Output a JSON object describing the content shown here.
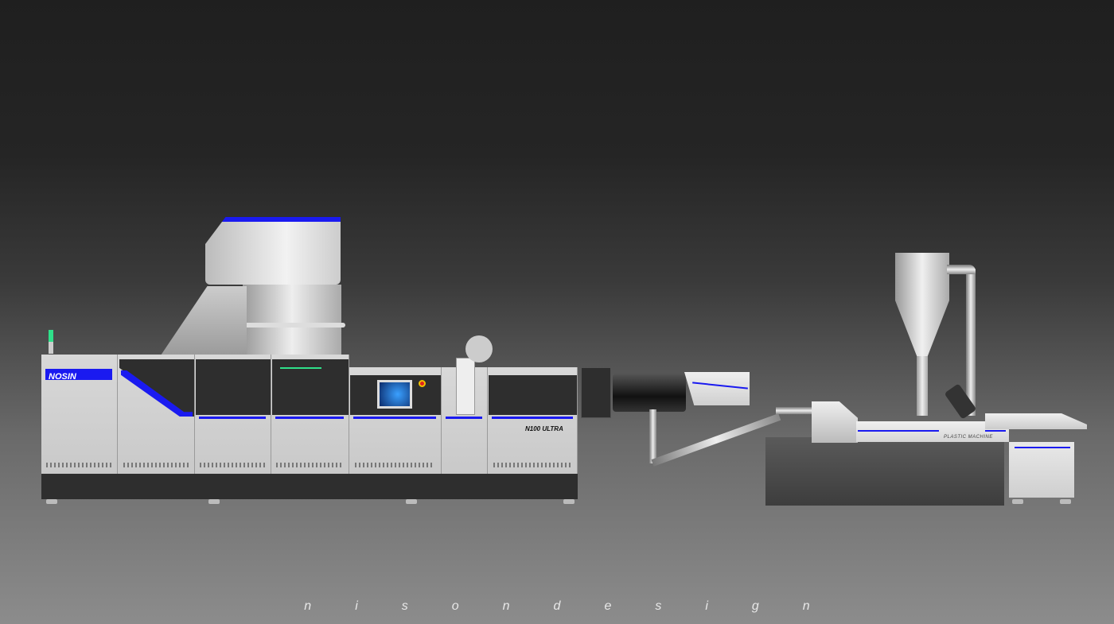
{
  "machine": {
    "brand_label": "NOSIN",
    "model_label": "N100 ULTRA",
    "pelletizer_label": "PLASTIC MACHINE"
  },
  "footer": {
    "text": "nisondesign"
  },
  "colors": {
    "accent_blue": "#1a1af0",
    "accent_green": "#2fe08a",
    "panel": "#d0d0d0",
    "dark": "#2e2e2e"
  }
}
